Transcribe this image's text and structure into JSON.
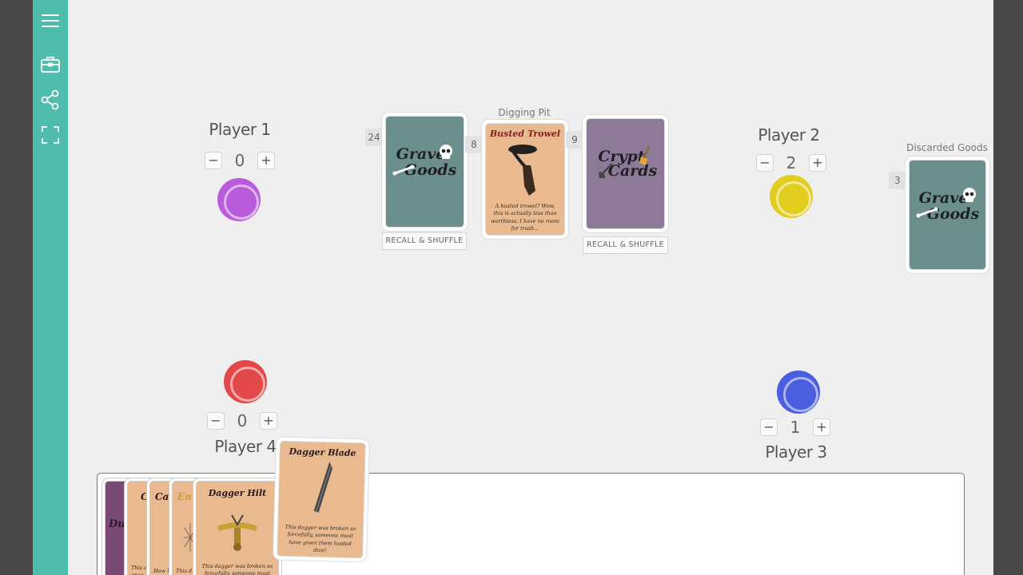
{
  "sidebar": {
    "icons": [
      "menu-icon",
      "briefcase-icon",
      "share-icon",
      "fullscreen-icon"
    ],
    "color": "#4fbdab"
  },
  "players": {
    "p1": {
      "name": "Player 1",
      "score": "0",
      "token_color": "#b85cdc",
      "minus": "−",
      "plus": "+"
    },
    "p2": {
      "name": "Player 2",
      "score": "2",
      "token_color": "#e2cd1e",
      "minus": "−",
      "plus": "+"
    },
    "p3": {
      "name": "Player 3",
      "score": "1",
      "token_color": "#4a5ee0",
      "minus": "−",
      "plus": "+"
    },
    "p4": {
      "name": "Player 4",
      "score": "0",
      "token_color": "#e24848",
      "minus": "−",
      "plus": "+"
    }
  },
  "piles": {
    "grave_deck": {
      "count": "24",
      "back_line1": "Grave",
      "back_line2": "Goods",
      "button": "RECALL & SHUFFLE"
    },
    "digging_pit": {
      "label": "Digging Pit",
      "count": "8",
      "card_title": "Busted Trowel",
      "card_text": "A busted trowel? Wow, this is actually less than worthless. I have no room for trash..."
    },
    "crypt_deck": {
      "count": "9",
      "back_line1": "Crypt",
      "back_line2": "Cards",
      "button": "RECALL & SHUFFLE"
    },
    "discarded": {
      "label": "Discarded Goods",
      "count": "3",
      "back_line1": "Grave",
      "back_line2": "Goods"
    }
  },
  "hand": {
    "partial_titles": [
      "Du",
      "C",
      "Can",
      "En"
    ],
    "partial_texts": [
      "This c once",
      "How l",
      "This d ed th"
    ],
    "dagger_hilt": {
      "title": "Dagger Hilt",
      "text": "This dagger was broken so forcefully, someone must hav"
    },
    "dagger_blade": {
      "title": "Dagger Blade",
      "text": "This dagger was broken so forcefully, someone must have given them loaded dice!"
    }
  },
  "colors": {
    "grave_back": "#6b8f8d",
    "crypt_back": "#8d7a97",
    "card_face": "#e9b98f",
    "felt": "#efefef"
  }
}
